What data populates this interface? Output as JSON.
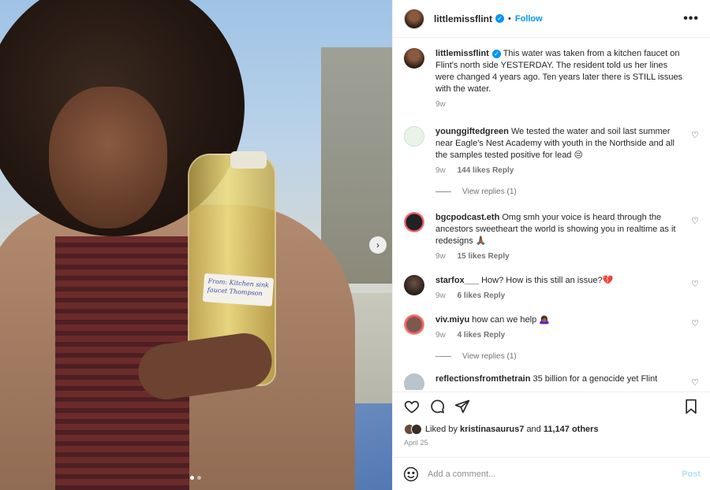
{
  "post": {
    "username": "littlemissflint",
    "follow_label": "Follow",
    "separator": "•",
    "more_label": "•••",
    "next_label": "›",
    "bottle_label": "From: Kitchen sink faucet Thompson",
    "caption": {
      "username": "littlemissflint",
      "text": "This water was taken from a kitchen faucet on Flint's north side YESTERDAY. The resident told us her lines were changed 4 years ago. Ten years later there is STILL issues with the water.",
      "age": "9w"
    },
    "likes_prefix": "Liked by",
    "liked_by": "kristinasaurus7",
    "likes_and": "and",
    "likes_count": "11,147 others",
    "date": "April 25"
  },
  "comments": [
    {
      "username": "younggiftedgreen",
      "text": "We tested the water and soil last summer near Eagle's Nest Academy with youth in the Northside and all the samples tested positive for lead 😔",
      "age": "9w",
      "likes": "144 likes",
      "reply": "Reply",
      "view_replies": "View replies (1)",
      "avatar_color": "#e9f3ea"
    },
    {
      "username": "bgcpodcast.eth",
      "text": "Omg smh your voice is heard through the ancestors sweetheart the world is showing you in realtime as it redesigns 🙏🏾",
      "age": "9w",
      "likes": "15 likes",
      "reply": "Reply",
      "avatar_color": "#111111"
    },
    {
      "username": "starfox___",
      "text": "How? How is this still an issue?💔",
      "age": "9w",
      "likes": "6 likes",
      "reply": "Reply",
      "avatar_color": "#3b2f2a"
    },
    {
      "username": "viv.miyu",
      "text": "how can we help 🙇🏾‍♀️",
      "age": "9w",
      "likes": "4 likes",
      "reply": "Reply",
      "view_replies": "View replies (1)",
      "avatar_color": "#5a4036"
    },
    {
      "username": "reflectionsfromthetrain",
      "text": "35 billion for a genocide yet Flint",
      "avatar_color": "#b9c4cc"
    }
  ],
  "add_comment": {
    "placeholder": "Add a comment...",
    "post_label": "Post"
  },
  "colors": {
    "accent": "#0095f6",
    "muted": "#8e8e8e",
    "post_disabled": "#b2dffc"
  },
  "icons": [
    "heart-icon",
    "comment-icon",
    "share-icon",
    "bookmark-icon",
    "emoji-icon",
    "verified-icon",
    "more-icon",
    "chevron-right-icon"
  ]
}
